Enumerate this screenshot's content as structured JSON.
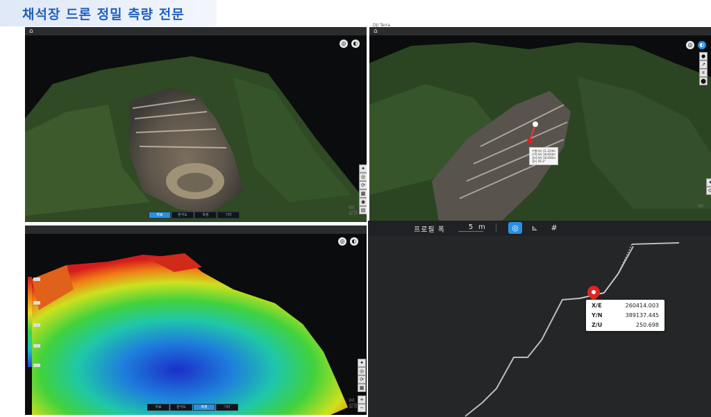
{
  "header": {
    "title": "채석장 드론 정밀 측량 전문"
  },
  "panel1": {
    "tabs": [
      "자료",
      "분석도",
      "측정",
      "기타"
    ],
    "watermark_line1": "Wi",
    "watermark_line2": "설정"
  },
  "panel2": {
    "window_title": "DJI Terra",
    "measure_lines": [
      "수평거리 11.224m",
      "수직거리 18.934m",
      "경사거리 18.936m",
      "경사 59.3°"
    ],
    "watermark_line1": "Wi"
  },
  "panel3": {
    "tabs": [
      "자료",
      "분석도",
      "측정",
      "기타"
    ],
    "watermark_line1": "Wi",
    "watermark_line2": "설정"
  },
  "profile": {
    "label": "프로필 폭",
    "value": "5",
    "unit": "m",
    "coords": [
      {
        "key": "X/E",
        "value": "260414.003"
      },
      {
        "key": "Y/N",
        "value": "389137.445"
      },
      {
        "key": "Z/U",
        "value": "250.698"
      }
    ]
  },
  "colors": {
    "title": "#1f5fbf",
    "accent": "#2a8fe0",
    "legend": [
      "#d51b1b",
      "#f07c17",
      "#f2d91c",
      "#3fd54b",
      "#1ec3c0",
      "#2c3fd6"
    ]
  }
}
